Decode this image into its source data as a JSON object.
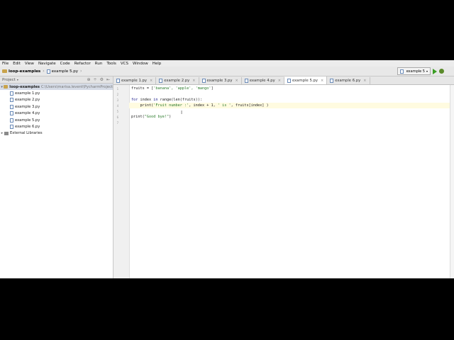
{
  "menu": [
    "File",
    "Edit",
    "View",
    "Navigate",
    "Code",
    "Refactor",
    "Run",
    "Tools",
    "VCS",
    "Window",
    "Help"
  ],
  "breadcrumb": {
    "project": "loop-examples",
    "file": "example 5.py"
  },
  "run_config": "example 5",
  "project_panel": {
    "title": "Project",
    "root": {
      "name": "loop-examples",
      "path": "C:\\Users\\marisa.levent\\PycharmProject"
    },
    "files": [
      "example 1.py",
      "example 2.py",
      "example 3.py",
      "example 4.py",
      "example 5.py",
      "example 6.py"
    ],
    "external": "External Libraries"
  },
  "tabs": [
    "example 1.py",
    "example 2.py",
    "example 3.py",
    "example 4.py",
    "example 5.py",
    "example 6.py"
  ],
  "active_tab_index": 4,
  "line_numbers": [
    "1",
    "2",
    "3",
    "4",
    "5",
    "6",
    "7"
  ],
  "code": {
    "l1_a": "fruits = [",
    "l1_b": "'banana', 'apple', 'mango'",
    "l1_c": "]",
    "l3_kw": "for",
    "l3_a": " index ",
    "l3_kw2": "in",
    "l3_b": " range(len(fruits)):",
    "l4_a": "    print(",
    "l4_s1": "'Fruit number :'",
    "l4_b": ", index + 1, ",
    "l4_s2": "' is '",
    "l4_c": ", fruits[index] )",
    "l6_a": "print(",
    "l6_s": "\"Good bye!\"",
    "l6_b": ")"
  },
  "colors": {
    "accent_selected": "#d5dbe6",
    "current_line": "#fffbe0",
    "string": "#2a7a2a"
  }
}
